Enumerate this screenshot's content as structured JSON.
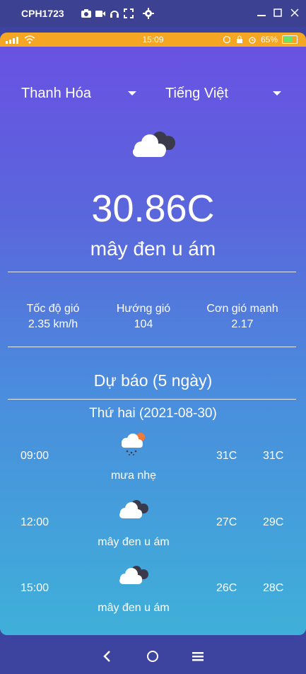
{
  "window": {
    "title": "CPH1723",
    "icons": [
      "camera-icon",
      "video-icon",
      "headphones-icon",
      "fullscreen-icon",
      "gear-icon"
    ],
    "controls": [
      "minimize-icon",
      "maximize-icon",
      "close-icon"
    ]
  },
  "status_bar": {
    "signal_text": "",
    "time": "15:09",
    "battery": "65%",
    "color": "#f5a623"
  },
  "selectors": {
    "city": "Thanh Hóa",
    "language": "Tiếng Việt"
  },
  "current": {
    "icon": "dark-cloud-icon",
    "temperature": "30.86C",
    "description": "mây đen u ám"
  },
  "stats": [
    {
      "label": "Tốc độ gió",
      "value": "2.35 km/h"
    },
    {
      "label": "Hướng gió",
      "value": "104"
    },
    {
      "label": "Cơn gió mạnh",
      "value": "2.17"
    }
  ],
  "forecast": {
    "title": "Dự báo (5 ngày)",
    "day": "Thứ hai (2021-08-30)",
    "rows": [
      {
        "time": "09:00",
        "icon": "rain-cloud-icon",
        "description": "mưa nhẹ",
        "min": "31C",
        "max": "31C"
      },
      {
        "time": "12:00",
        "icon": "dark-cloud-icon",
        "description": "mây đen u ám",
        "min": "27C",
        "max": "29C"
      },
      {
        "time": "15:00",
        "icon": "dark-cloud-icon",
        "description": "mây đen u ám",
        "min": "26C",
        "max": "28C"
      }
    ]
  },
  "nav": [
    "back-icon",
    "home-icon",
    "menu-icon"
  ],
  "colors": {
    "gradient_top": "#6a50e3",
    "gradient_bottom": "#3fb0d9",
    "window_bar": "#3c4192"
  }
}
